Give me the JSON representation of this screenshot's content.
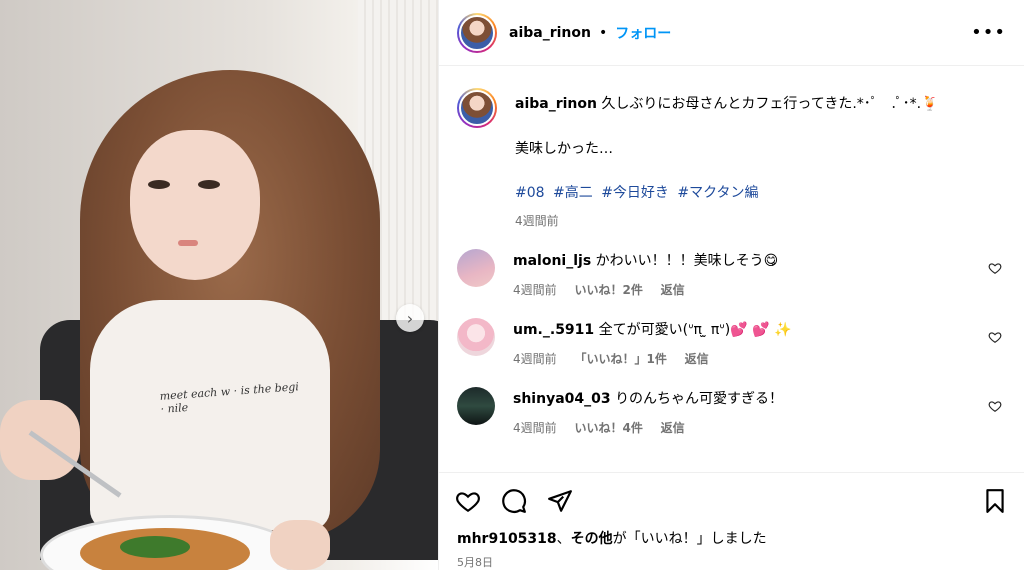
{
  "header": {
    "username": "aiba_rinon",
    "separator": "•",
    "follow_label": "フォロー",
    "more_icon": "more-horizontal-icon"
  },
  "caption": {
    "username": "aiba_rinon",
    "text": "久しぶりにお母さんとカフェ行ってきた.*･ﾟ　.ﾟ･*.🍹",
    "line2": "美味しかった…",
    "hashtags": [
      "#08",
      "#高二",
      "#今日好き",
      "#マクタン編"
    ],
    "time": "4週間前"
  },
  "comments": [
    {
      "username": "maloni_ljs",
      "text": "かわいい！！！美味しそう😋",
      "time": "4週間前",
      "likes": "いいね！2件",
      "reply": "返信"
    },
    {
      "username": "um._.5911",
      "text": "全てが可愛い(ᐡπ ̫ πᐡ)💕 💕 ✨",
      "time": "4週間前",
      "likes": "「いいね！」1件",
      "reply": "返信"
    },
    {
      "username": "shinya04_03",
      "text": "りのんちゃん可愛すぎる！",
      "time": "4週間前",
      "likes": "いいね！4件",
      "reply": "返信"
    }
  ],
  "photo": {
    "shirt_text": "meet each w · is the begi · nile",
    "next_icon": "chevron-right-icon"
  },
  "likes": {
    "user": "mhr9105318",
    "mid": "、",
    "others": "その他",
    "suffix": "が「いいね！」しました"
  },
  "date": "5月8日",
  "colors": {
    "accent": "#0095f6",
    "hashtag": "#1e4a9b",
    "muted": "#737373"
  }
}
